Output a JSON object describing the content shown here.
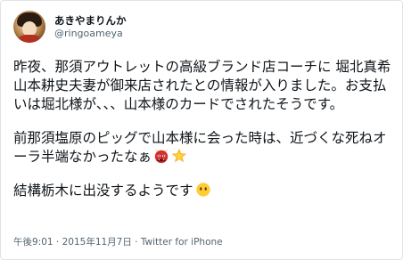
{
  "author": {
    "display_name": "あきやまりんか",
    "handle": "@ringoameya",
    "avatar_icon": "profile-photo"
  },
  "tweet": {
    "paragraph_1": "昨夜、那須アウトレットの高級ブランド店コーチに 堀北真希 山本耕史夫妻が御来店されたとの情報が入りました。お支払いは堀北様が、、、山本様のカードでされたそうです。",
    "paragraph_2": "前那須塩原のピッグで山本様に会った時は、近づくな死ねオーラ半端なかったなぁ",
    "paragraph_2_emojis": [
      "ogre-face-emoji",
      "glowing-star-emoji"
    ],
    "paragraph_3": "結構栃木に出没するようです",
    "paragraph_3_emojis": [
      "face-without-mouth-emoji"
    ]
  },
  "meta": {
    "timestamp": "午後9:01 · 2015年11月7日",
    "separator": " · ",
    "source": "Twitter for iPhone"
  },
  "colors": {
    "text": "#0f1419",
    "secondary": "#536471",
    "border": "#dfe3e6"
  }
}
